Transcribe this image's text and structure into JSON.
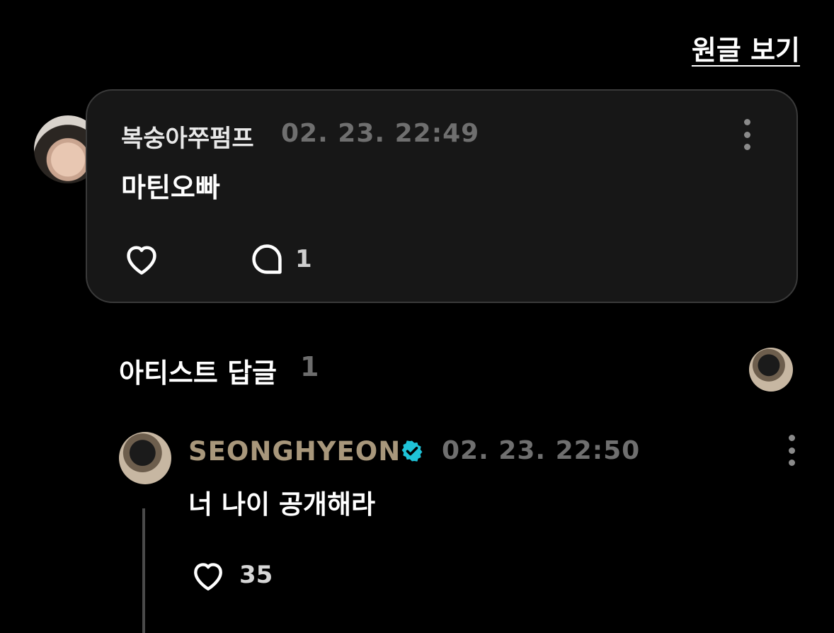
{
  "header": {
    "view_original": "원글 보기"
  },
  "fan_comment": {
    "author": "복숭아쭈펌프",
    "date": "02. 23. 22:49",
    "text": "마틴오빠",
    "reply_count": "1",
    "icons": [
      "heart-icon",
      "comment-icon",
      "kebab-menu-icon"
    ]
  },
  "artist_replies": {
    "title": "아티스트 답글",
    "count": "1"
  },
  "artist_reply": {
    "author": "SEONGHYEON",
    "date": "02. 23. 22:50",
    "text": "너 나이 공개해라",
    "like_count": "35",
    "verified": true,
    "author_color": "#a8977b",
    "verified_color": "#1fc3d8",
    "icons": [
      "verified-badge-icon",
      "heart-icon",
      "kebab-menu-icon"
    ]
  }
}
